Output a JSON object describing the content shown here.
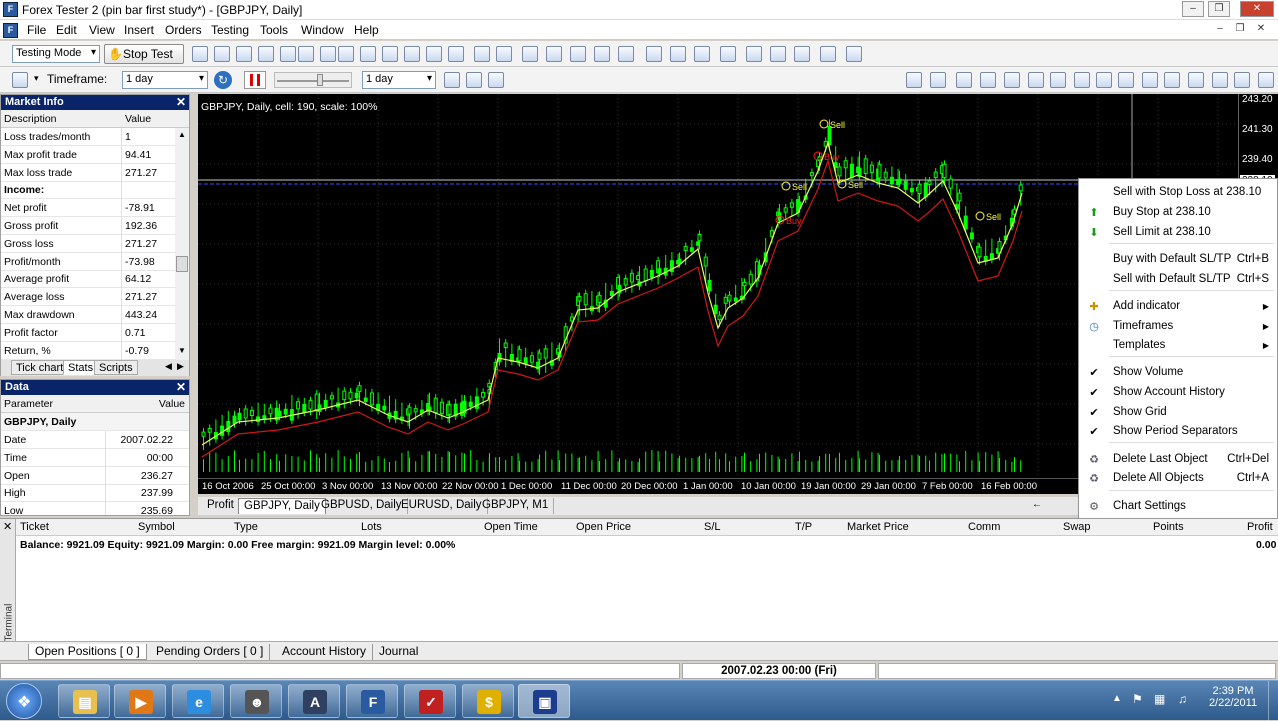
{
  "window": {
    "title": "Forex Tester 2  (pin bar first study*) - [GBPJPY, Daily]",
    "icon": "app-icon"
  },
  "menu": [
    "File",
    "Edit",
    "View",
    "Insert",
    "Orders",
    "Testing",
    "Tools",
    "Window",
    "Help"
  ],
  "toolbar": {
    "mode": "Testing Mode",
    "stop_test": "Stop Test",
    "timeframe_label": "Timeframe:",
    "timeframe_value": "1 day",
    "speed_value": "1 day"
  },
  "market_info": {
    "title": "Market Info",
    "columns": [
      "Description",
      "Value"
    ],
    "rows": [
      {
        "desc": "Loss trades/month",
        "val": "1"
      },
      {
        "desc": "Max profit trade",
        "val": "94.41"
      },
      {
        "desc": "Max loss trade",
        "val": "271.27"
      },
      {
        "desc": "Income:",
        "val": ""
      },
      {
        "desc": "Net profit",
        "val": "-78.91"
      },
      {
        "desc": "Gross profit",
        "val": "192.36"
      },
      {
        "desc": "Gross loss",
        "val": "271.27"
      },
      {
        "desc": "Profit/month",
        "val": "-73.98"
      },
      {
        "desc": "Average profit",
        "val": "64.12"
      },
      {
        "desc": "Average loss",
        "val": "271.27"
      },
      {
        "desc": "Max drawdown",
        "val": "443.24"
      },
      {
        "desc": "Profit factor",
        "val": "0.71"
      },
      {
        "desc": "Return, %",
        "val": "-0.79"
      }
    ],
    "tabs": [
      "Tick chart",
      "Stats",
      "Scripts"
    ]
  },
  "data_panel": {
    "title": "Data",
    "columns": [
      "Parameter",
      "Value"
    ],
    "group": "GBPJPY, Daily",
    "rows": [
      {
        "desc": "Date",
        "val": "2007.02.22"
      },
      {
        "desc": "Time",
        "val": "00:00"
      },
      {
        "desc": "Open",
        "val": "236.27"
      },
      {
        "desc": "High",
        "val": "237.99"
      },
      {
        "desc": "Low",
        "val": "235.69"
      }
    ]
  },
  "chart": {
    "header": "GBPJPY, Daily, cell: 190, scale: 100%",
    "price_labels": [
      "243.20",
      "241.30",
      "239.40",
      "238.10"
    ],
    "date_labels": [
      "16 Oct 2006",
      "25 Oct 00:00",
      "3 Nov 00:00",
      "13 Nov 00:00",
      "22 Nov 00:00",
      "1 Dec 00:00",
      "11 Dec 00:00",
      "20 Dec 00:00",
      "1 Jan 00:00",
      "10 Jan 00:00",
      "19 Jan 00:00",
      "29 Jan 00:00",
      "7 Feb 00:00",
      "16 Feb 00:00"
    ],
    "markers": [
      "Sell",
      "Sell",
      "Sell",
      "Sell",
      "Buy",
      "Buy"
    ],
    "colors": {
      "up": "#00ff00",
      "fast_ma": "#e8ff60",
      "slow_ma": "#d01818",
      "grid": "#303030"
    }
  },
  "chart_tabs": [
    "Profit",
    "GBPJPY, Daily",
    "GBPUSD, Daily",
    "EURUSD, Daily",
    "GBPJPY, M1"
  ],
  "context_menu": [
    {
      "label": "Sell with Stop Loss at 238.10",
      "key": "",
      "icon": ""
    },
    {
      "label": "Buy Stop at 238.10",
      "key": "",
      "icon": "up-arrow-icon"
    },
    {
      "label": "Sell Limit at 238.10",
      "key": "",
      "icon": "down-arrow-icon"
    },
    {
      "label": "Buy with Default SL/TP",
      "key": "Ctrl+B",
      "icon": ""
    },
    {
      "label": "Sell with Default SL/TP",
      "key": "Ctrl+S",
      "icon": ""
    },
    {
      "label": "Add indicator",
      "key": "",
      "icon": "add-indicator-icon"
    },
    {
      "label": "Timeframes",
      "key": "",
      "icon": "clock-icon"
    },
    {
      "label": "Templates",
      "key": "",
      "icon": ""
    },
    {
      "label": "Show Volume",
      "key": "",
      "icon": "check-icon"
    },
    {
      "label": "Show Account History",
      "key": "",
      "icon": "check-icon"
    },
    {
      "label": "Show Grid",
      "key": "",
      "icon": "check-icon"
    },
    {
      "label": "Show Period Separators",
      "key": "",
      "icon": "check-icon"
    },
    {
      "label": "Delete Last Object",
      "key": "Ctrl+Del",
      "icon": "delete-last-icon"
    },
    {
      "label": "Delete All Objects",
      "key": "Ctrl+A",
      "icon": "delete-all-icon"
    },
    {
      "label": "Chart Settings",
      "key": "",
      "icon": "settings-icon"
    }
  ],
  "terminal": {
    "label": "Terminal",
    "columns": [
      "Ticket",
      "Symbol",
      "Type",
      "Lots",
      "Open Time",
      "Open Price",
      "S/L",
      "T/P",
      "Market Price",
      "Comm",
      "Swap",
      "Points",
      "Profit"
    ],
    "balance_line": "Balance: 9921.09 Equity: 9921.09 Margin: 0.00 Free margin: 9921.09 Margin level: 0.00%",
    "balance_profit": "0.00",
    "tabs": [
      "Open Positions  [ 0 ]",
      "Pending Orders  [ 0 ]",
      "Account History",
      "Journal"
    ]
  },
  "status": {
    "datetime": "2007.02.23 00:00 (Fri)"
  },
  "taskbar": {
    "time": "2:39 PM",
    "date": "2/22/2011"
  }
}
